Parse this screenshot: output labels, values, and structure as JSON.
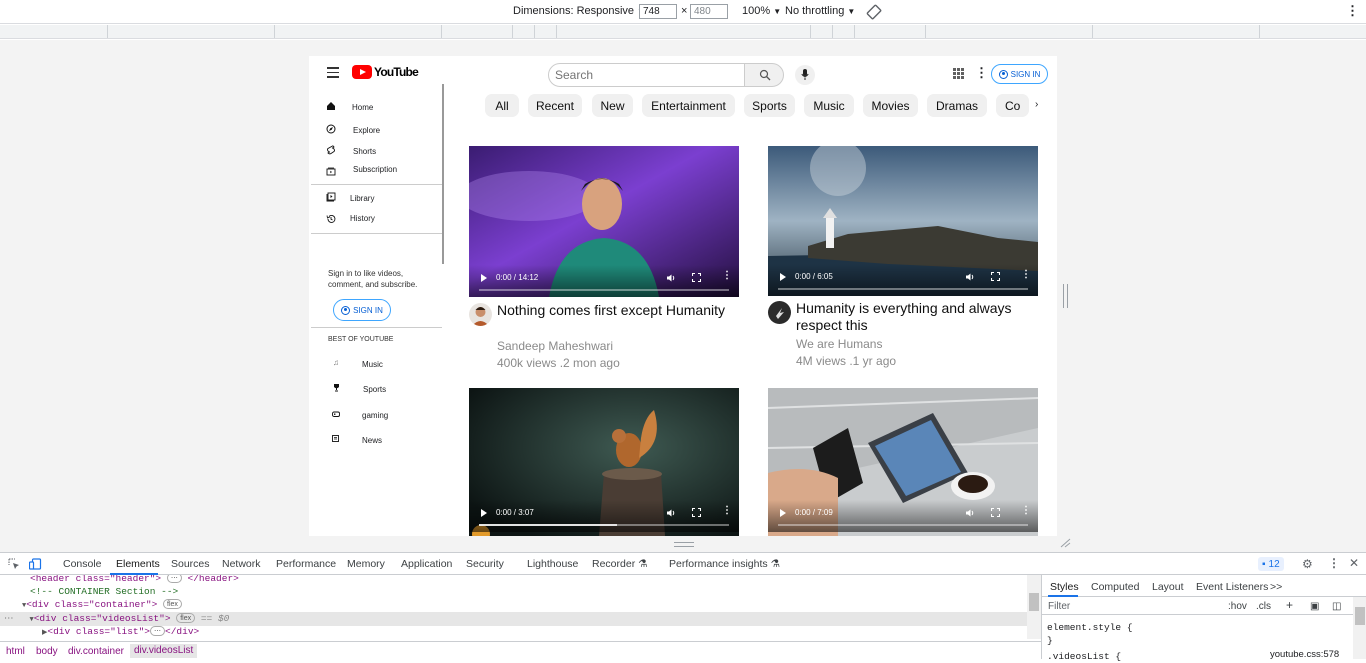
{
  "device_toolbar": {
    "dimensions_label": "Dimensions: Responsive",
    "width": "748",
    "times": "×",
    "height": "480",
    "zoom": "100%",
    "throttling": "No throttling"
  },
  "youtube": {
    "logo_text": "YouTube",
    "search_placeholder": "Search",
    "signin_label": "SIGN IN",
    "sidebar": {
      "primary": [
        {
          "label": "Home",
          "icon": "home-icon"
        },
        {
          "label": "Explore",
          "icon": "explore-icon"
        },
        {
          "label": "Shorts",
          "icon": "shorts-icon"
        },
        {
          "label": "Subscription",
          "icon": "subscription-icon"
        }
      ],
      "secondary": [
        {
          "label": "Library",
          "icon": "library-icon"
        },
        {
          "label": "History",
          "icon": "history-icon"
        }
      ],
      "signin_note": "Sign in to like videos, comment, and subscribe.",
      "signin_label": "SIGN IN",
      "best_of_heading": "BEST OF YOUTUBE",
      "best_of": [
        {
          "label": "Music",
          "icon": "music-icon"
        },
        {
          "label": "Sports",
          "icon": "trophy-icon"
        },
        {
          "label": "gaming",
          "icon": "gamepad-icon"
        },
        {
          "label": "News",
          "icon": "news-icon"
        }
      ]
    },
    "chips": [
      "All",
      "Recent",
      "New",
      "Entertainment",
      "Sports",
      "Music",
      "Movies",
      "Dramas",
      "Co"
    ],
    "chip_next": "›",
    "videos": [
      {
        "title": "Nothing comes first except Humanity",
        "channel": "Sandeep Maheshwari",
        "stats": "400k views .2 mon ago",
        "time": "0:00 / 14:12",
        "progress": 0
      },
      {
        "title": "Humanity is everything and always respect this",
        "channel": "We are Humans",
        "stats": "4M views .1 yr ago",
        "time": "0:00 / 6:05",
        "progress": 0
      },
      {
        "title": "",
        "channel": "",
        "stats": "",
        "time": "0:00 / 3:07",
        "progress": 0.55
      },
      {
        "title": "",
        "channel": "",
        "stats": "",
        "time": "0:00 / 7:09",
        "progress": 0
      }
    ]
  },
  "devtools": {
    "tabs": [
      "Console",
      "Elements",
      "Sources",
      "Network",
      "Performance",
      "Memory",
      "Application",
      "Security",
      "Lighthouse",
      "Recorder",
      "Performance insights"
    ],
    "active_tab": "Elements",
    "issues_count": "12",
    "dom": {
      "line1": "<header class=\"header\">",
      "line1_tail": "</header>",
      "comment": "<!-- CONTAINER Section -->",
      "container_open": "<div class=\"container\">",
      "videos_open": "<div class=\"videosList\">",
      "selected_marker": "== $0",
      "list_line": "<div class=\"list\">",
      "list_close": "</div>",
      "flex_badge": "flex"
    },
    "breadcrumbs": [
      "html",
      "body",
      "div.container",
      "div.videosList"
    ],
    "styles_tabs": [
      "Styles",
      "Computed",
      "Layout",
      "Event Listeners",
      ">>"
    ],
    "filter_placeholder": "Filter",
    "hov": ":hov",
    "cls": ".cls",
    "css_rule_open": "element.style {",
    "css_rule_close": "}",
    "css_next_selector": ".videosList {",
    "css_source": "youtube.css:578"
  }
}
